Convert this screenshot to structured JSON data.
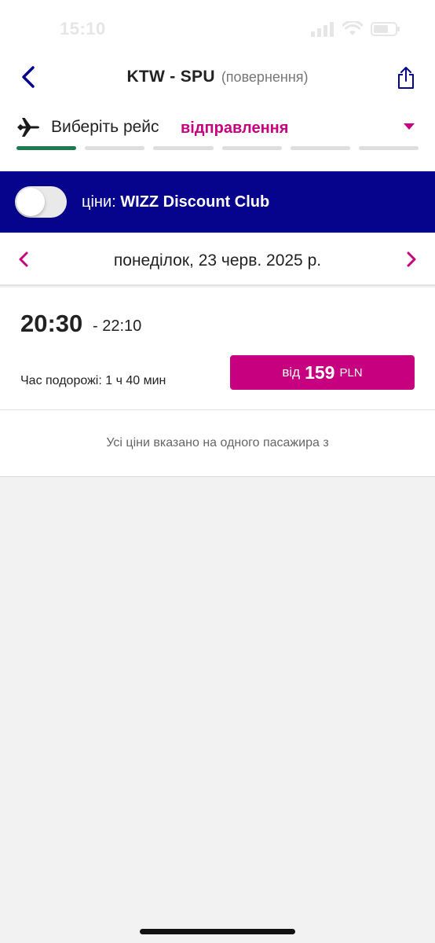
{
  "status_bar": {
    "time": "15:10"
  },
  "header": {
    "route": "KTW - SPU",
    "route_type": "(повернення)"
  },
  "step": {
    "label": "Виберіть рейс",
    "value": "відправлення",
    "progress_total": 6,
    "progress_active": 1
  },
  "club": {
    "prefix": "ціни:",
    "name": "WIZZ Discount Club",
    "enabled": false
  },
  "date": {
    "text": "понеділок, 23 черв. 2025 р."
  },
  "flight": {
    "departure": "20:30",
    "arrival": "- 22:10",
    "duration": "Час подорожі: 1 ч 40 мин",
    "price_from": "від",
    "price": "159",
    "currency": "PLN"
  },
  "note": "Усі ціни вказано на одного пасажира з",
  "colors": {
    "brand_navy": "#06038d",
    "brand_magenta": "#c6007e",
    "progress_active": "#1b7a4f"
  }
}
